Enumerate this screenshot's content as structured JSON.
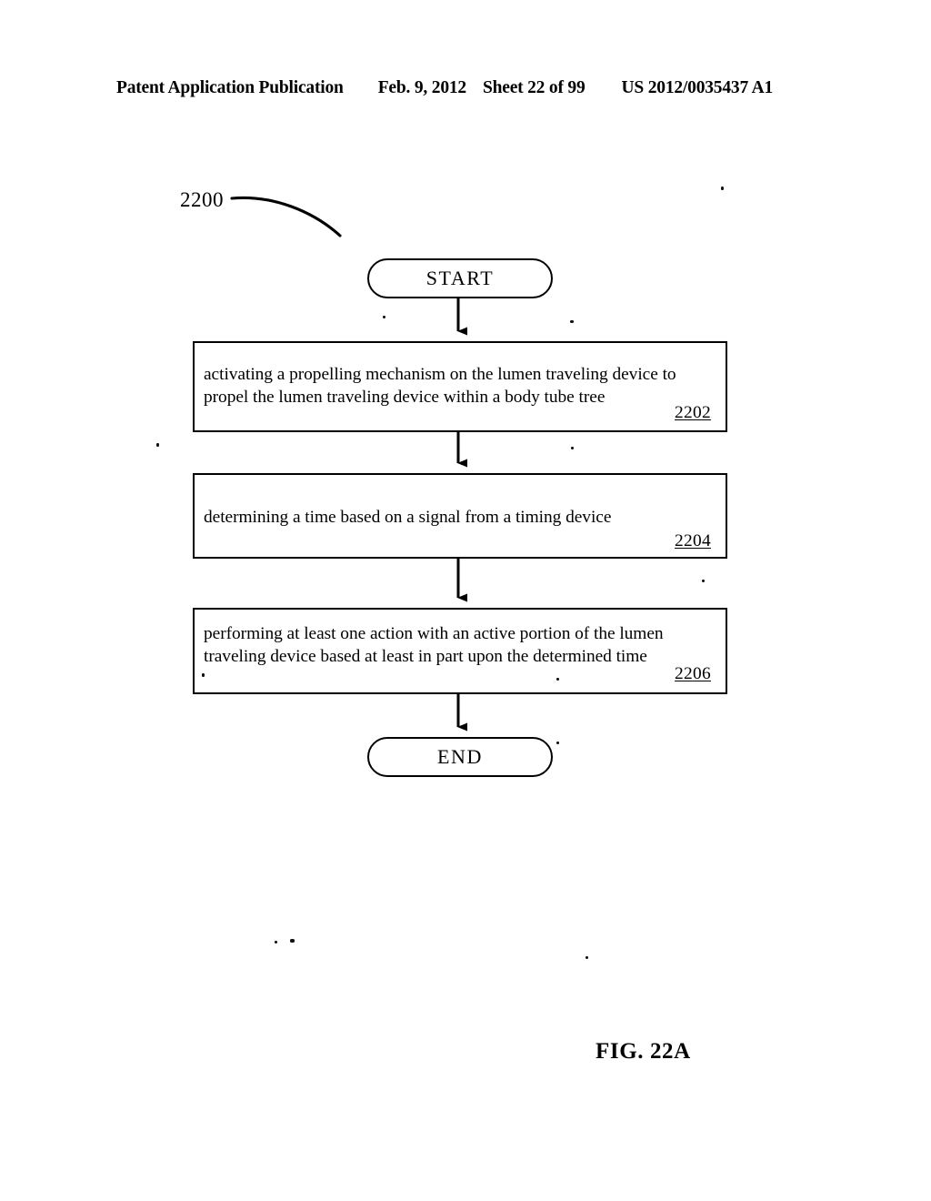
{
  "header": {
    "publication": "Patent Application Publication",
    "date": "Feb. 9, 2012",
    "sheet": "Sheet 22 of 99",
    "publication_number": "US 2012/0035437 A1"
  },
  "figure": {
    "caption": "FIG. 22A",
    "diagram_reference": "2200",
    "type": "flowchart",
    "nodes": [
      {
        "id": "start",
        "shape": "terminator",
        "label": "START"
      },
      {
        "id": "step-2202",
        "shape": "process",
        "label": "activating a propelling mechanism on the lumen traveling device to propel the lumen traveling device within a body tube tree",
        "reference": "2202"
      },
      {
        "id": "step-2204",
        "shape": "process",
        "label": "determining a time based on a signal from a timing device",
        "reference": "2204"
      },
      {
        "id": "step-2206",
        "shape": "process",
        "label": "performing at least one action with an active portion of the lumen traveling device based at least in part upon the determined time",
        "reference": "2206"
      },
      {
        "id": "end",
        "shape": "terminator",
        "label": "END"
      }
    ],
    "edges": [
      {
        "from": "start",
        "to": "step-2202",
        "arrow": "down"
      },
      {
        "from": "step-2202",
        "to": "step-2204",
        "arrow": "down"
      },
      {
        "from": "step-2204",
        "to": "step-2206",
        "arrow": "down"
      },
      {
        "from": "step-2206",
        "to": "end",
        "arrow": "down"
      }
    ]
  },
  "colors": {
    "ink": "#000000",
    "paper": "#ffffff"
  }
}
